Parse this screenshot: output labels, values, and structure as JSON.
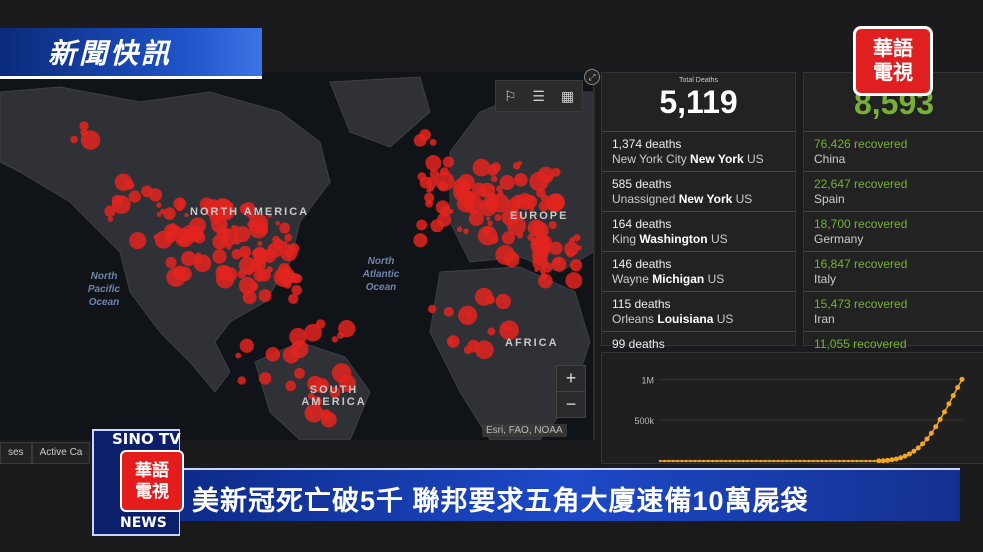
{
  "map": {
    "labels": {
      "north_america": "NORTH AMERICA",
      "europe": "EUROPE",
      "africa": "AFRICA",
      "south_america": "SOUTH AMERICA",
      "north_pacific": "North Pacific Ocean",
      "north_atlantic": "North Atlantic Ocean"
    },
    "zoom_in": "+",
    "zoom_out": "−",
    "attribution": "Esri, FAO, NOAA",
    "tools": [
      "bookmark-icon",
      "list-icon",
      "qr-icon"
    ],
    "bottom_tabs": [
      "ses",
      "Active Ca"
    ]
  },
  "total_deaths": {
    "label": "Total Deaths",
    "value": "5,119",
    "rows": [
      {
        "count": "1,374 deaths",
        "place": "New York City",
        "region": "New York",
        "country": "US"
      },
      {
        "count": "585 deaths",
        "place": "Unassigned",
        "region": "New York",
        "country": "US"
      },
      {
        "count": "164 deaths",
        "place": "King",
        "region": "Washington",
        "country": "US"
      },
      {
        "count": "146 deaths",
        "place": "Wayne",
        "region": "Michigan",
        "country": "US"
      },
      {
        "count": "115 deaths",
        "place": "Orleans",
        "region": "Louisiana",
        "country": "US"
      },
      {
        "count": "99 deaths",
        "place": "",
        "region": "",
        "country": ""
      }
    ]
  },
  "recovered": {
    "value": "8,593",
    "rows": [
      {
        "count": "76,426 recovered",
        "country": "China"
      },
      {
        "count": "22,647 recovered",
        "country": "Spain"
      },
      {
        "count": "18,700 recovered",
        "country": "Germany"
      },
      {
        "count": "16,847 recovered",
        "country": "Italy"
      },
      {
        "count": "15,473 recovered",
        "country": "Iran"
      },
      {
        "count": "11,055 recovered",
        "country": ""
      }
    ]
  },
  "chart_data": {
    "type": "line",
    "title": "",
    "xlabel": "",
    "ylabel": "",
    "yticks": [
      "1M",
      "500k"
    ],
    "ylim": [
      0,
      1200000
    ],
    "series": [
      {
        "name": "",
        "color": "#f5a623",
        "values": [
          0,
          0,
          0,
          0,
          0,
          0,
          0,
          0,
          0,
          0,
          0,
          0,
          0,
          0,
          0,
          0,
          0,
          0,
          0,
          0,
          0,
          0,
          0,
          0,
          0,
          0,
          0,
          0,
          0,
          0,
          0,
          0,
          0,
          0,
          0,
          0,
          0,
          0,
          0,
          0,
          0,
          0,
          0,
          0,
          0,
          0,
          0,
          0,
          0,
          0,
          1000,
          3000,
          8000,
          15000,
          25000,
          40000,
          60000,
          85000,
          120000,
          160000,
          210000,
          270000,
          340000,
          420000,
          510000,
          600000,
          700000,
          800000,
          900000,
          1000000
        ]
      }
    ]
  },
  "news": {
    "flash": "新聞快訊",
    "logo_top": "華語",
    "logo_bottom": "電視",
    "headline": "美新冠死亡破5千  聯邦要求五角大廈速備10萬屍袋",
    "sino_top": "SINO TV",
    "sino_bottom": "NEWS",
    "sino_side": "華語"
  },
  "colors": {
    "accent_red": "#e02020",
    "banner_blue": "#1d49c8",
    "recovered_green": "#78b036",
    "curve_orange": "#f5a623"
  }
}
